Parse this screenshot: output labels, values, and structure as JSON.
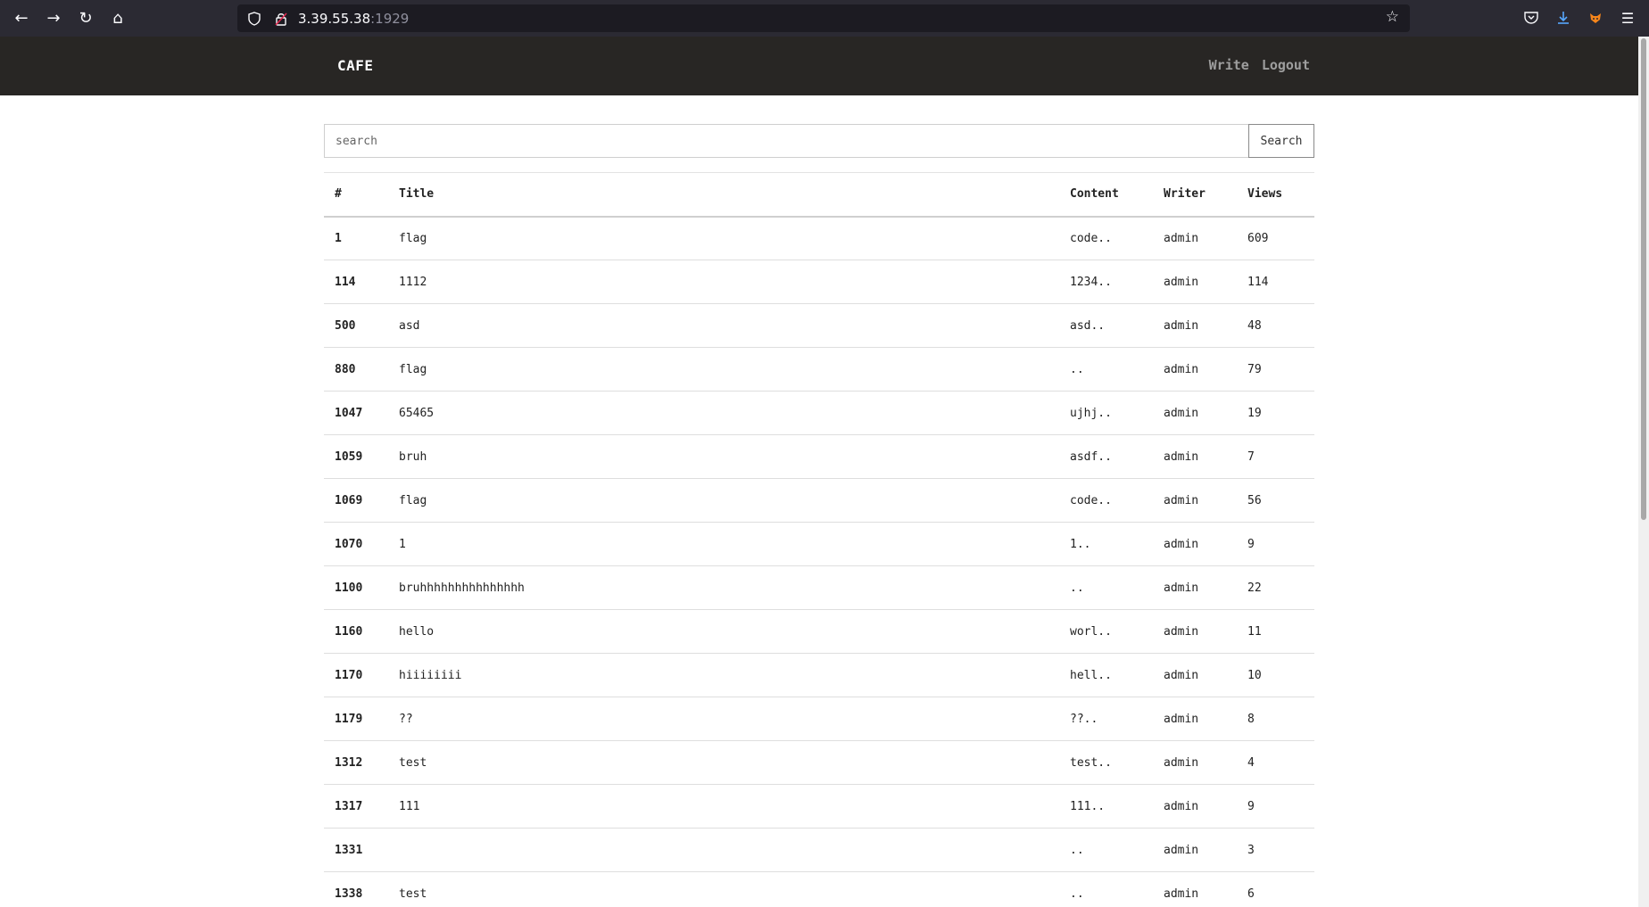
{
  "browser": {
    "url_host": "3.39.55.38",
    "url_port": ":1929"
  },
  "site": {
    "brand": "CAFE",
    "nav": [
      {
        "label": "Write"
      },
      {
        "label": "Logout"
      }
    ]
  },
  "search": {
    "placeholder": "search",
    "value": "",
    "button_label": "Search"
  },
  "table": {
    "headers": [
      "#",
      "Title",
      "Content",
      "Writer",
      "Views"
    ],
    "rows": [
      {
        "id": "1",
        "title": "flag",
        "content": "code..",
        "writer": "admin",
        "views": "609"
      },
      {
        "id": "114",
        "title": "1112",
        "content": "1234..",
        "writer": "admin",
        "views": "114"
      },
      {
        "id": "500",
        "title": "asd",
        "content": "asd..",
        "writer": "admin",
        "views": "48"
      },
      {
        "id": "880",
        "title": "flag",
        "content": "..",
        "writer": "admin",
        "views": "79"
      },
      {
        "id": "1047",
        "title": "65465",
        "content": "ujhj..",
        "writer": "admin",
        "views": "19"
      },
      {
        "id": "1059",
        "title": "bruh",
        "content": "asdf..",
        "writer": "admin",
        "views": "7"
      },
      {
        "id": "1069",
        "title": "flag",
        "content": "code..",
        "writer": "admin",
        "views": "56"
      },
      {
        "id": "1070",
        "title": "1",
        "content": "1..",
        "writer": "admin",
        "views": "9"
      },
      {
        "id": "1100",
        "title": "bruhhhhhhhhhhhhhhh",
        "content": "..",
        "writer": "admin",
        "views": "22"
      },
      {
        "id": "1160",
        "title": "hello",
        "content": "worl..",
        "writer": "admin",
        "views": "11"
      },
      {
        "id": "1170",
        "title": "hiiiiiiii",
        "content": "hell..",
        "writer": "admin",
        "views": "10"
      },
      {
        "id": "1179",
        "title": "??",
        "content": "??..",
        "writer": "admin",
        "views": "8"
      },
      {
        "id": "1312",
        "title": "test",
        "content": "test..",
        "writer": "admin",
        "views": "4"
      },
      {
        "id": "1317",
        "title": "111",
        "content": "111..",
        "writer": "admin",
        "views": "9"
      },
      {
        "id": "1331",
        "title": "",
        "content": "..",
        "writer": "admin",
        "views": "3"
      },
      {
        "id": "1338",
        "title": "test",
        "content": "..",
        "writer": "admin",
        "views": "6"
      }
    ]
  }
}
